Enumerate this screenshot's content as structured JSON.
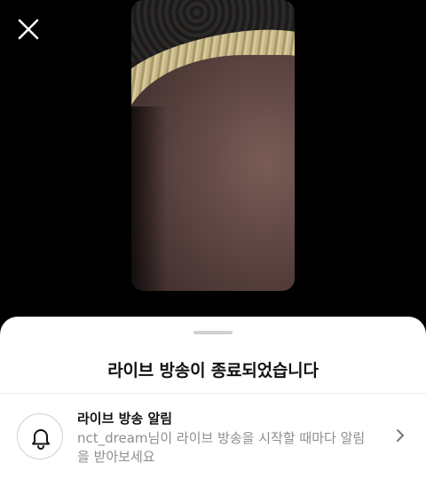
{
  "header": {
    "close_icon": "close-icon"
  },
  "sheet": {
    "title": "라이브 방송이 종료되었습니다",
    "notification": {
      "title": "라이브 방송 알림",
      "description": "nct_dream님이 라이브 방송을 시작할 때마다 알림을 받아보세요",
      "icon": "bell-icon",
      "chevron_icon": "chevron-right-icon"
    }
  },
  "colors": {
    "background": "#000000",
    "sheet": "#ffffff",
    "secondary_text": "#8e8e8e"
  }
}
